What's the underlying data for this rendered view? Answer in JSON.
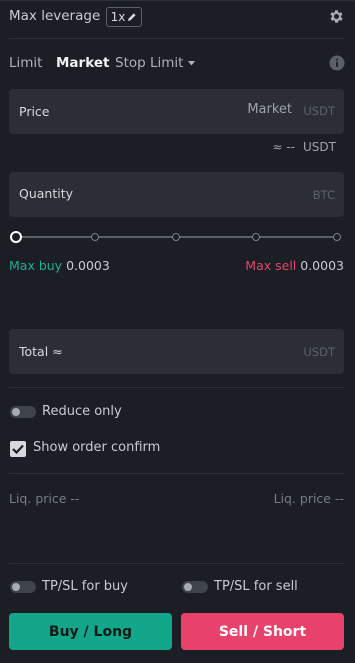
{
  "header": {
    "max_leverage_label": "Max leverage",
    "leverage_value": "1x",
    "icons": [
      "pencil-icon",
      "gear-icon"
    ]
  },
  "tabs": {
    "limit": "Limit",
    "market": "Market",
    "stop_limit": "Stop Limit",
    "active": "Market"
  },
  "price": {
    "label": "Price",
    "value": "Market",
    "unit": "USDT",
    "approx_symbol": "≈ --",
    "approx_unit": "USDT"
  },
  "quantity": {
    "label": "Quantity",
    "unit": "BTC"
  },
  "slider": {
    "stops": 5,
    "value_fraction": 0
  },
  "max": {
    "buy_label": "Max buy",
    "buy_value": "0.0003",
    "sell_label": "Max sell",
    "sell_value": "0.0003"
  },
  "total": {
    "label": "Total ≈",
    "unit": "USDT"
  },
  "options": {
    "reduce_only": "Reduce only",
    "reduce_only_on": false,
    "show_order_confirm": "Show order confirm",
    "show_order_confirm_checked": true
  },
  "liq": {
    "left": "Liq. price --",
    "right": "Liq. price --"
  },
  "tpsl": {
    "buy_label": "TP/SL for buy",
    "buy_on": false,
    "sell_label": "TP/SL for sell",
    "sell_on": false
  },
  "actions": {
    "buy": "Buy / Long",
    "sell": "Sell / Short"
  },
  "colors": {
    "buy": "#13a68a",
    "sell": "#e8416c",
    "max_buy": "#1fae94",
    "max_sell": "#e0466f",
    "panel_bg": "#1b1e24",
    "field_bg": "#2b2e35"
  }
}
